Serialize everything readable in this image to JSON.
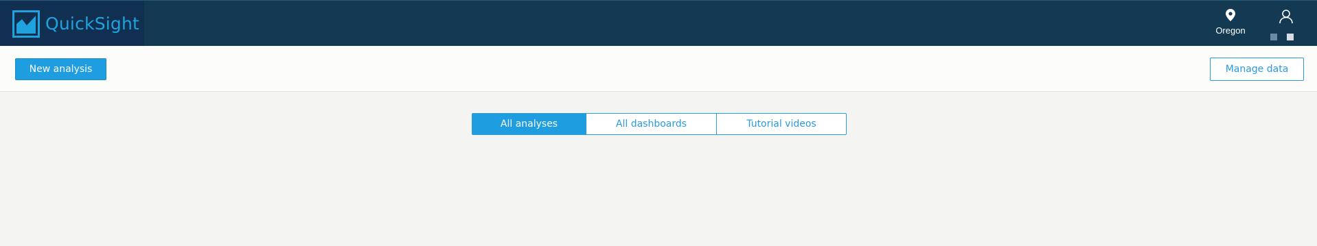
{
  "header": {
    "brand": "QuickSight",
    "logo_icon": "quicksight-logo-icon",
    "region_icon": "location-pin-icon",
    "region_label": "Oregon",
    "user_icon": "user-icon"
  },
  "toolbar": {
    "new_analysis_label": "New analysis",
    "manage_data_label": "Manage data"
  },
  "tabs": [
    {
      "label": "All analyses",
      "active": true
    },
    {
      "label": "All dashboards",
      "active": false
    },
    {
      "label": "Tutorial videos",
      "active": false
    }
  ],
  "colors": {
    "header_bg": "#143a53",
    "brand_bg": "#112f50",
    "accent": "#1e9ee0",
    "page_bg": "#f4f4f2"
  }
}
